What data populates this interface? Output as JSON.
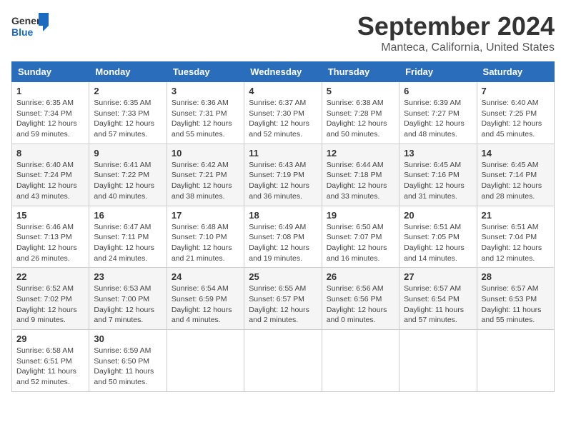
{
  "logo": {
    "line1": "General",
    "line2": "Blue"
  },
  "title": "September 2024",
  "subtitle": "Manteca, California, United States",
  "weekdays": [
    "Sunday",
    "Monday",
    "Tuesday",
    "Wednesday",
    "Thursday",
    "Friday",
    "Saturday"
  ],
  "weeks": [
    [
      {
        "day": "1",
        "info": "Sunrise: 6:35 AM\nSunset: 7:34 PM\nDaylight: 12 hours\nand 59 minutes."
      },
      {
        "day": "2",
        "info": "Sunrise: 6:35 AM\nSunset: 7:33 PM\nDaylight: 12 hours\nand 57 minutes."
      },
      {
        "day": "3",
        "info": "Sunrise: 6:36 AM\nSunset: 7:31 PM\nDaylight: 12 hours\nand 55 minutes."
      },
      {
        "day": "4",
        "info": "Sunrise: 6:37 AM\nSunset: 7:30 PM\nDaylight: 12 hours\nand 52 minutes."
      },
      {
        "day": "5",
        "info": "Sunrise: 6:38 AM\nSunset: 7:28 PM\nDaylight: 12 hours\nand 50 minutes."
      },
      {
        "day": "6",
        "info": "Sunrise: 6:39 AM\nSunset: 7:27 PM\nDaylight: 12 hours\nand 48 minutes."
      },
      {
        "day": "7",
        "info": "Sunrise: 6:40 AM\nSunset: 7:25 PM\nDaylight: 12 hours\nand 45 minutes."
      }
    ],
    [
      {
        "day": "8",
        "info": "Sunrise: 6:40 AM\nSunset: 7:24 PM\nDaylight: 12 hours\nand 43 minutes."
      },
      {
        "day": "9",
        "info": "Sunrise: 6:41 AM\nSunset: 7:22 PM\nDaylight: 12 hours\nand 40 minutes."
      },
      {
        "day": "10",
        "info": "Sunrise: 6:42 AM\nSunset: 7:21 PM\nDaylight: 12 hours\nand 38 minutes."
      },
      {
        "day": "11",
        "info": "Sunrise: 6:43 AM\nSunset: 7:19 PM\nDaylight: 12 hours\nand 36 minutes."
      },
      {
        "day": "12",
        "info": "Sunrise: 6:44 AM\nSunset: 7:18 PM\nDaylight: 12 hours\nand 33 minutes."
      },
      {
        "day": "13",
        "info": "Sunrise: 6:45 AM\nSunset: 7:16 PM\nDaylight: 12 hours\nand 31 minutes."
      },
      {
        "day": "14",
        "info": "Sunrise: 6:45 AM\nSunset: 7:14 PM\nDaylight: 12 hours\nand 28 minutes."
      }
    ],
    [
      {
        "day": "15",
        "info": "Sunrise: 6:46 AM\nSunset: 7:13 PM\nDaylight: 12 hours\nand 26 minutes."
      },
      {
        "day": "16",
        "info": "Sunrise: 6:47 AM\nSunset: 7:11 PM\nDaylight: 12 hours\nand 24 minutes."
      },
      {
        "day": "17",
        "info": "Sunrise: 6:48 AM\nSunset: 7:10 PM\nDaylight: 12 hours\nand 21 minutes."
      },
      {
        "day": "18",
        "info": "Sunrise: 6:49 AM\nSunset: 7:08 PM\nDaylight: 12 hours\nand 19 minutes."
      },
      {
        "day": "19",
        "info": "Sunrise: 6:50 AM\nSunset: 7:07 PM\nDaylight: 12 hours\nand 16 minutes."
      },
      {
        "day": "20",
        "info": "Sunrise: 6:51 AM\nSunset: 7:05 PM\nDaylight: 12 hours\nand 14 minutes."
      },
      {
        "day": "21",
        "info": "Sunrise: 6:51 AM\nSunset: 7:04 PM\nDaylight: 12 hours\nand 12 minutes."
      }
    ],
    [
      {
        "day": "22",
        "info": "Sunrise: 6:52 AM\nSunset: 7:02 PM\nDaylight: 12 hours\nand 9 minutes."
      },
      {
        "day": "23",
        "info": "Sunrise: 6:53 AM\nSunset: 7:00 PM\nDaylight: 12 hours\nand 7 minutes."
      },
      {
        "day": "24",
        "info": "Sunrise: 6:54 AM\nSunset: 6:59 PM\nDaylight: 12 hours\nand 4 minutes."
      },
      {
        "day": "25",
        "info": "Sunrise: 6:55 AM\nSunset: 6:57 PM\nDaylight: 12 hours\nand 2 minutes."
      },
      {
        "day": "26",
        "info": "Sunrise: 6:56 AM\nSunset: 6:56 PM\nDaylight: 12 hours\nand 0 minutes."
      },
      {
        "day": "27",
        "info": "Sunrise: 6:57 AM\nSunset: 6:54 PM\nDaylight: 11 hours\nand 57 minutes."
      },
      {
        "day": "28",
        "info": "Sunrise: 6:57 AM\nSunset: 6:53 PM\nDaylight: 11 hours\nand 55 minutes."
      }
    ],
    [
      {
        "day": "29",
        "info": "Sunrise: 6:58 AM\nSunset: 6:51 PM\nDaylight: 11 hours\nand 52 minutes."
      },
      {
        "day": "30",
        "info": "Sunrise: 6:59 AM\nSunset: 6:50 PM\nDaylight: 11 hours\nand 50 minutes."
      },
      null,
      null,
      null,
      null,
      null
    ]
  ]
}
